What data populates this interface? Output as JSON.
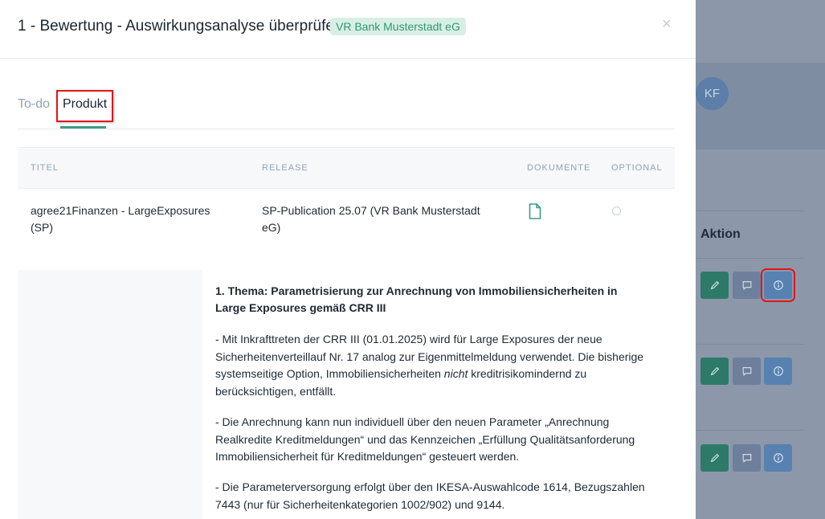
{
  "modal": {
    "title": "1 - Bewertung - Auswirkungsanalyse überprüfen",
    "tag": "VR Bank Musterstadt eG",
    "close_symbol": "×"
  },
  "tabs": [
    {
      "label": "To-do",
      "active": false
    },
    {
      "label": "Produkt",
      "active": true
    }
  ],
  "table": {
    "headers": [
      "TITEL",
      "RELEASE",
      "DOKUMENTE",
      "OPTIONAL"
    ],
    "rows": [
      {
        "title_line1": "agree21Finanzen - LargeExposures",
        "title_line2": "(SP)",
        "release_line1": "SP-Publication 25.07 (VR Bank Musterstadt",
        "release_line2": "eG)",
        "document_icon": "file-icon",
        "optional": false
      }
    ]
  },
  "detail": {
    "title_line1": "1. Thema: Parametrisierung zur Anrechnung von Immobiliensicherheiten in",
    "title_line2": "Large Exposures gemäß CRR III",
    "p1_line1": "- Mit Inkrafttreten der CRR III (01.01.2025) wird für Large Exposures der neue",
    "p1_line2": "Sicherheitenverteillauf Nr. 17 analog zur Eigenmittelmeldung verwendet. Die bisherige",
    "p1_line3a": "systemseitige Option, Immobiliensicherheiten ",
    "p1_line3b": "nicht",
    "p1_line3c": " kreditrisikomindernd zu",
    "p1_line4": "berücksichtigen, entfällt.",
    "p2_line1": "- Die Anrechnung kann nun individuell über den neuen Parameter „Anrechnung",
    "p2_line2": "Realkredite Kreditmeldungen“ und das Kennzeichen „Erfüllung Qualitätsanforderung",
    "p2_line3": "Immobiliensicherheit für Kreditmeldungen“ gesteuert werden.",
    "p3_line1": "- Die Parameterversorgung erfolgt über den IKESA-Auswahlcode 1614, Bezugszahlen",
    "p3_line2": "7443 (nur für Sicherheitenkategorien 1002/902) und 9144."
  },
  "background": {
    "avatar_initials": "KF",
    "aktion_label": "Aktion",
    "action_rows": 3
  },
  "colors": {
    "accent_green": "#3b9e80",
    "tag_bg": "#d9efe6",
    "highlight_red": "#e0161b",
    "edit_button": "#2e7a68",
    "comment_button": "#6e7f9c",
    "info_button": "#5781b0"
  }
}
